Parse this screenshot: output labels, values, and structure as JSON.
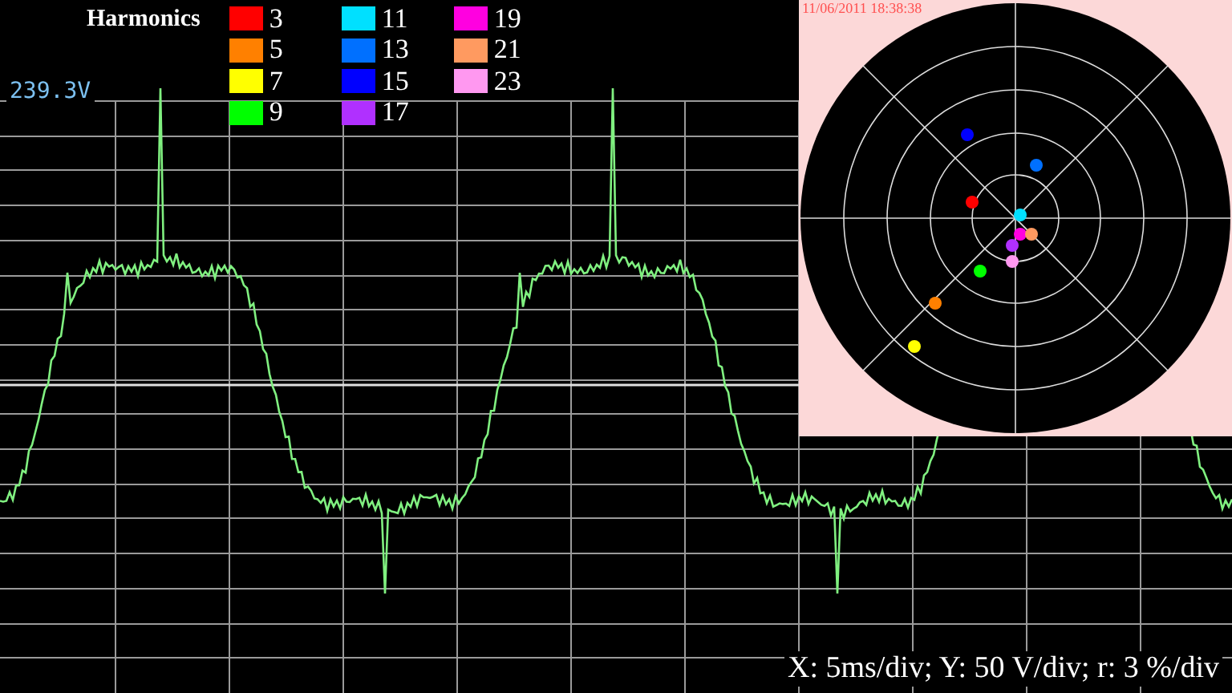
{
  "legend": {
    "title": "Harmonics",
    "harmonics": [
      {
        "label": "3",
        "color": "#ff0000"
      },
      {
        "label": "5",
        "color": "#ff8000"
      },
      {
        "label": "7",
        "color": "#ffff00"
      },
      {
        "label": "9",
        "color": "#00ff00"
      },
      {
        "label": "11",
        "color": "#00e0ff"
      },
      {
        "label": "13",
        "color": "#0070ff"
      },
      {
        "label": "15",
        "color": "#0000ff"
      },
      {
        "label": "17",
        "color": "#b030ff"
      },
      {
        "label": "19",
        "color": "#ff00e0"
      },
      {
        "label": "21",
        "color": "#ff9a60"
      },
      {
        "label": "23",
        "color": "#ff98f0"
      }
    ]
  },
  "voltage_reading": "239.3V",
  "polar_plot": {
    "timestamp": "11/06/2011 18:38:38"
  },
  "scale_label": "X: 5ms/div; Y: 50 V/div; r: 3 %/div"
}
